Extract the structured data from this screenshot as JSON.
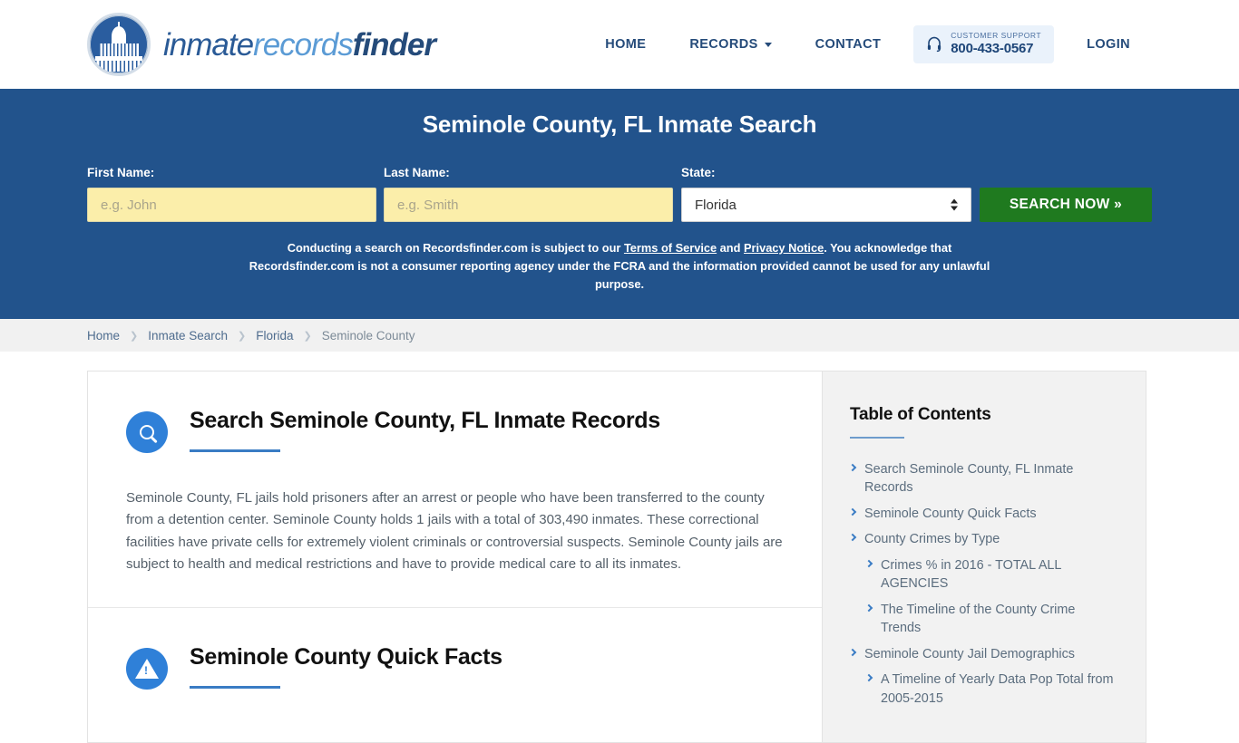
{
  "header": {
    "logo": {
      "part1": "inmate",
      "part2": "records",
      "part3": "finder",
      "seal_icon": "capitol-dome-seal-icon"
    },
    "nav": [
      {
        "label": "HOME",
        "name": "nav-home"
      },
      {
        "label": "RECORDS",
        "name": "nav-records",
        "has_caret": true
      },
      {
        "label": "CONTACT",
        "name": "nav-contact"
      }
    ],
    "support": {
      "icon": "headset-icon",
      "label": "CUSTOMER SUPPORT",
      "phone": "800-433-0567"
    },
    "login_label": "LOGIN"
  },
  "banner": {
    "title": "Seminole County, FL Inmate Search",
    "first_name": {
      "label": "First Name:",
      "placeholder": "e.g. John",
      "value": ""
    },
    "last_name": {
      "label": "Last Name:",
      "placeholder": "e.g. Smith",
      "value": ""
    },
    "state": {
      "label": "State:",
      "value": "Florida"
    },
    "search_button": "SEARCH NOW »",
    "disclaimer": {
      "part1": "Conducting a search on Recordsfinder.com is subject to our ",
      "link1": "Terms of Service",
      "part2": " and ",
      "link2": "Privacy Notice",
      "part3": ". You acknowledge that Recordsfinder.com is not a consumer reporting agency under the FCRA and the information provided cannot be used for any unlawful purpose."
    },
    "bg_color": "#22538c",
    "button_color": "#1f7a1f",
    "input_color": "#fbeeaa"
  },
  "breadcrumb": {
    "items": [
      {
        "label": "Home",
        "current": false
      },
      {
        "label": "Inmate Search",
        "current": false
      },
      {
        "label": "Florida",
        "current": false
      },
      {
        "label": "Seminole County",
        "current": true
      }
    ],
    "separator": "❯"
  },
  "main": {
    "sections": [
      {
        "icon": "search-magnifier-icon",
        "title": "Search Seminole County, FL Inmate Records",
        "body": "Seminole County, FL jails hold prisoners after an arrest or people who have been transferred to the county from a detention center. Seminole County holds 1 jails with a total of 303,490 inmates. These correctional facilities have private cells for extremely violent criminals or controversial suspects. Seminole County jails are subject to health and medical restrictions and have to provide medical care to all its inmates."
      },
      {
        "icon": "warning-triangle-icon",
        "title": "Seminole County Quick Facts",
        "body": ""
      }
    ]
  },
  "toc": {
    "title": "Table of Contents",
    "items": [
      {
        "label": "Search Seminole County, FL Inmate Records",
        "sub": false
      },
      {
        "label": "Seminole County Quick Facts",
        "sub": false
      },
      {
        "label": "County Crimes by Type",
        "sub": false
      },
      {
        "label": "Crimes % in 2016 - TOTAL ALL AGENCIES",
        "sub": true
      },
      {
        "label": "The Timeline of the County Crime Trends",
        "sub": true
      },
      {
        "label": "Seminole County Jail Demographics",
        "sub": false
      },
      {
        "label": "A Timeline of Yearly Data Pop Total from 2005-2015",
        "sub": true
      }
    ]
  }
}
